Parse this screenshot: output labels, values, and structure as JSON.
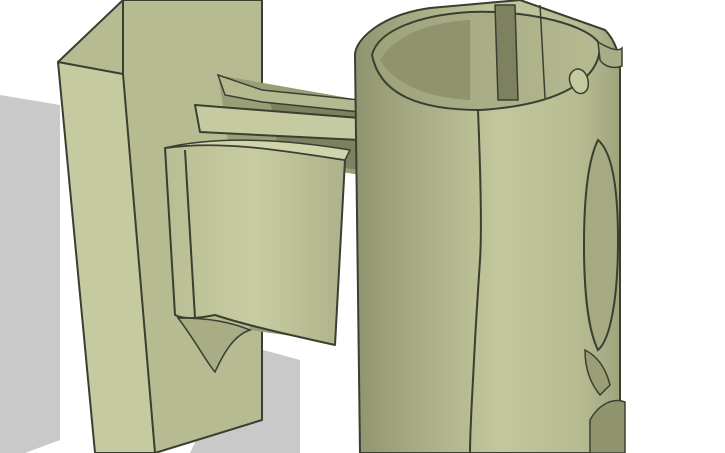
{
  "scene": {
    "subject": "",
    "colors": {
      "background": "#ffffff",
      "shadow": "#c9c9c9",
      "face_light": "#c6caa0",
      "face_mid": "#b5b98f",
      "face_dark": "#8f946e",
      "face_inner": "#9ea27b",
      "face_deep": "#7d8160",
      "edge": "#3c3e31"
    }
  }
}
